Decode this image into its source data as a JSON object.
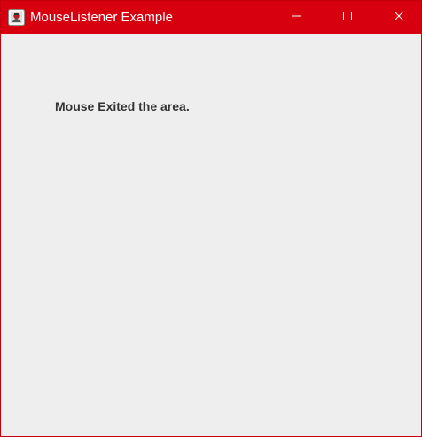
{
  "window": {
    "title": "MouseListener Example",
    "accent_color": "#d6000f",
    "icons": {
      "app": "java-app-icon",
      "minimize": "minimize-icon",
      "maximize": "maximize-icon",
      "close": "close-icon"
    }
  },
  "content": {
    "message": "Mouse Exited the area."
  }
}
